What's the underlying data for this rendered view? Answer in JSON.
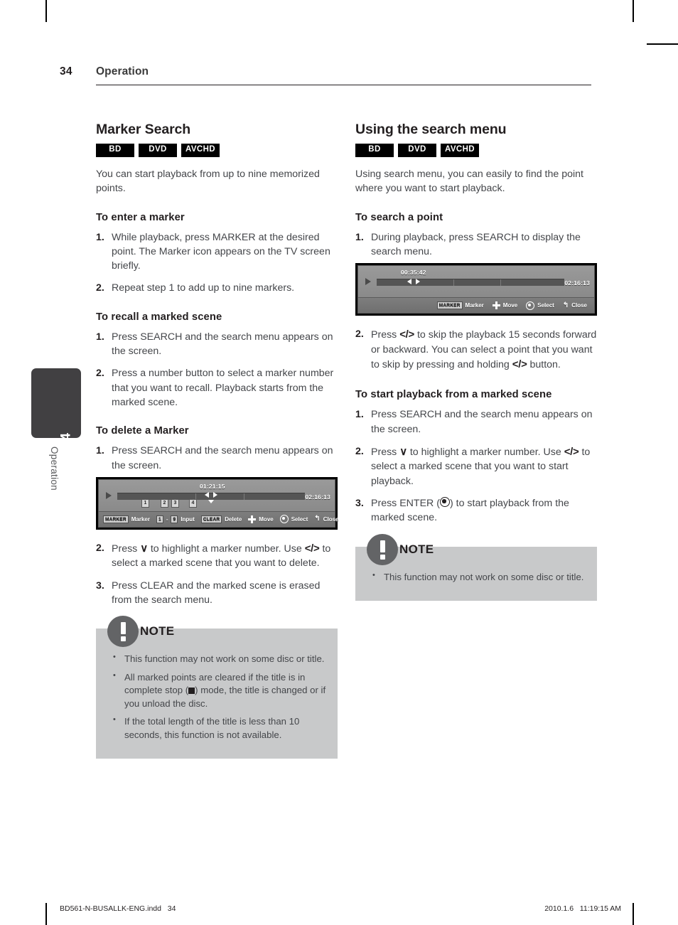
{
  "header": {
    "page_number": "34",
    "title": "Operation"
  },
  "side_tab": {
    "chapter_number": "4",
    "chapter_label": "Operation"
  },
  "left_column": {
    "section_title": "Marker Search",
    "badges": [
      "BD",
      "DVD",
      "AVCHD"
    ],
    "intro": "You can start playback from up to nine memorized points.",
    "sub1": {
      "title": "To enter a marker",
      "steps": [
        {
          "num": "1.",
          "text": "While playback, press MARKER at the desired point. The Marker icon appears on the TV screen briefly."
        },
        {
          "num": "2.",
          "text": "Repeat step 1 to add up to nine markers."
        }
      ]
    },
    "sub2": {
      "title": "To recall a marked scene",
      "steps": [
        {
          "num": "1.",
          "text": "Press SEARCH and the search menu appears on the screen."
        },
        {
          "num": "2.",
          "text": "Press a number button to select a marker number that you want to recall. Playback starts from the marked scene."
        }
      ]
    },
    "sub3": {
      "title": "To delete a Marker",
      "step1": {
        "num": "1.",
        "text": "Press SEARCH and the search menu appears on the screen."
      },
      "step2": {
        "num": "2.",
        "part1": "Press ",
        "key_down": "∨",
        "part2": " to highlight a marker number. Use ",
        "key_lr": "</>",
        "part3": " to select a marked scene that you want to delete."
      },
      "step3": {
        "num": "3.",
        "text": "Press CLEAR and the marked scene is erased from the search menu."
      }
    },
    "osd": {
      "current_time": "01:21:15",
      "total_time": "02:16:13",
      "marker_numbers": [
        "1",
        "2",
        "3",
        "4"
      ],
      "toolbar": [
        {
          "button": "MARKER",
          "label": "Marker",
          "icon": "button-key"
        },
        {
          "button": "1",
          "button2": "9",
          "label": "Input",
          "icon": "number-range"
        },
        {
          "button": "CLEAR",
          "label": "Delete",
          "icon": "button-key"
        },
        {
          "label": "Move",
          "icon": "dpad-icon"
        },
        {
          "label": "Select",
          "icon": "enter-circle-icon"
        },
        {
          "label": "Close",
          "icon": "return-icon"
        }
      ]
    },
    "note": {
      "word": "NOTE",
      "items": [
        {
          "text": "This function may not work on some disc or title."
        },
        {
          "pre": "All marked points are cleared if the title is in complete stop (",
          "post": ") mode, the title is changed or if you unload the disc.",
          "glyph": "stop-icon"
        },
        {
          "text": "If the total length of the title is less than 10 seconds, this function is not available."
        }
      ]
    }
  },
  "right_column": {
    "section_title": "Using the search menu",
    "badges": [
      "BD",
      "DVD",
      "AVCHD"
    ],
    "intro": "Using search menu, you can easily to find the point where you want to start playback.",
    "sub1": {
      "title": "To search a point",
      "step1": {
        "num": "1.",
        "text": "During playback, press SEARCH to display the search menu."
      },
      "step2": {
        "num": "2.",
        "part1": "Press ",
        "key_lr_a": "</>",
        "part2": " to skip the playback 15 seconds forward or backward. You can select a point that you want to skip by pressing and holding ",
        "key_lr_b": "</>",
        "part3": " button."
      }
    },
    "sub2": {
      "title": "To start playback from a marked scene",
      "step1": {
        "num": "1.",
        "text": "Press SEARCH and the search menu appears on the screen."
      },
      "step2": {
        "num": "2.",
        "part1": "Press ",
        "key_down": "∨",
        "part2": " to highlight a marker number. Use ",
        "key_lr": "</>",
        "part3": " to select a marked scene that you want to start playback."
      },
      "step3": {
        "num": "3.",
        "part1": "Press ENTER (",
        "part2": ") to start playback from the marked scene.",
        "glyph": "enter-circle-icon"
      }
    },
    "osd": {
      "current_time": "00:35:42",
      "total_time": "02:16:13",
      "toolbar": [
        {
          "button": "MARKER",
          "label": "Marker",
          "icon": "button-key"
        },
        {
          "label": "Move",
          "icon": "dpad-icon"
        },
        {
          "label": "Select",
          "icon": "enter-circle-icon"
        },
        {
          "label": "Close",
          "icon": "return-icon"
        }
      ]
    },
    "note": {
      "word": "NOTE",
      "items": [
        {
          "text": "This function may not work on some disc or title."
        }
      ]
    }
  },
  "footer": {
    "left": "BD561-N-BUSALLK-ENG.indd   34",
    "right": "2010.1.6   11:19:15 AM"
  }
}
